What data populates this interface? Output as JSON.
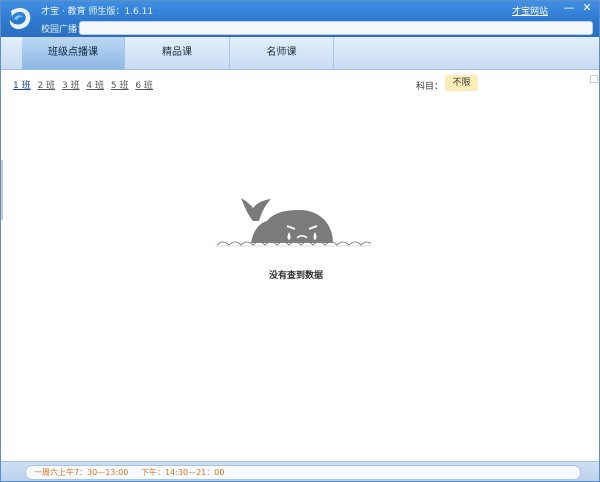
{
  "window": {
    "app_title": "才宝 · 教育  师生版：1.6.11",
    "broadcast_label": "校园广播：",
    "broadcast_text": "",
    "site_link": "才宝网站",
    "minimize_glyph": "—",
    "close_glyph": "✕"
  },
  "tabs": [
    {
      "label": "班级点播课",
      "active": true
    },
    {
      "label": "精品课",
      "active": false
    },
    {
      "label": "名师课",
      "active": false
    }
  ],
  "filters": {
    "classes": [
      "1 班",
      "2 班",
      "3 班",
      "4 班",
      "5 班",
      "6 班"
    ],
    "subject_label": "科目：",
    "subject_value": "不限"
  },
  "empty_state": {
    "icon": "crying-whale-icon",
    "message": "没有查到数据"
  },
  "status": {
    "schedule": "一周六上午7：30—13:00     下午：14:30—21：00"
  },
  "colors": {
    "titlebar": "#2d79cf",
    "tab_active": "#9cc2ec",
    "subject_bg": "#fcedb8",
    "status_text": "#e07416",
    "whale": "#7b7b7b"
  }
}
